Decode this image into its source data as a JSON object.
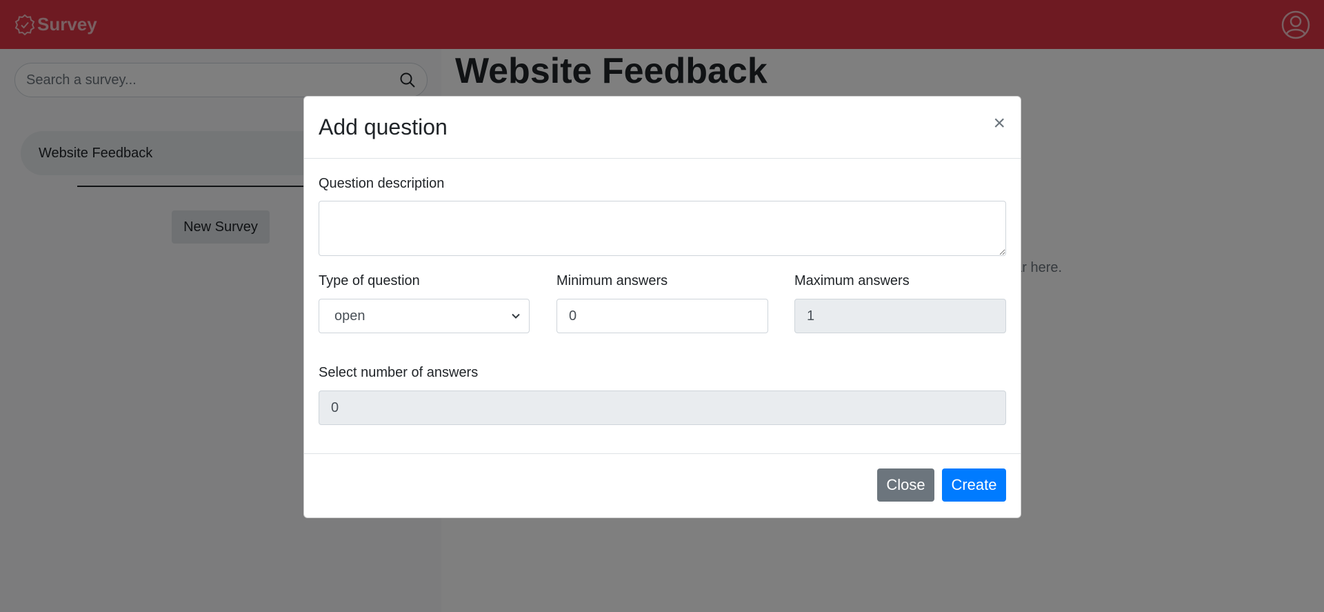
{
  "navbar": {
    "brand": "Survey",
    "brand_icon": "badge-check-icon",
    "user_icon": "user-circle-icon",
    "color": "#dc3545"
  },
  "sidebar": {
    "search_placeholder": "Search a survey...",
    "surveys": [
      "Website Feedback"
    ],
    "new_survey_label": "New Survey"
  },
  "main": {
    "title": "Website Feedback",
    "hint": "ear here."
  },
  "modal": {
    "title": "Add question",
    "close_symbol": "×",
    "question_description_label": "Question description",
    "question_description_value": "",
    "type_label": "Type of question",
    "type_value": "open",
    "min_label": "Minimum answers",
    "min_value": "0",
    "max_label": "Maximum answers",
    "max_value": "1",
    "num_answers_label": "Select number of answers",
    "num_answers_value": "0",
    "close_button": "Close",
    "create_button": "Create"
  }
}
